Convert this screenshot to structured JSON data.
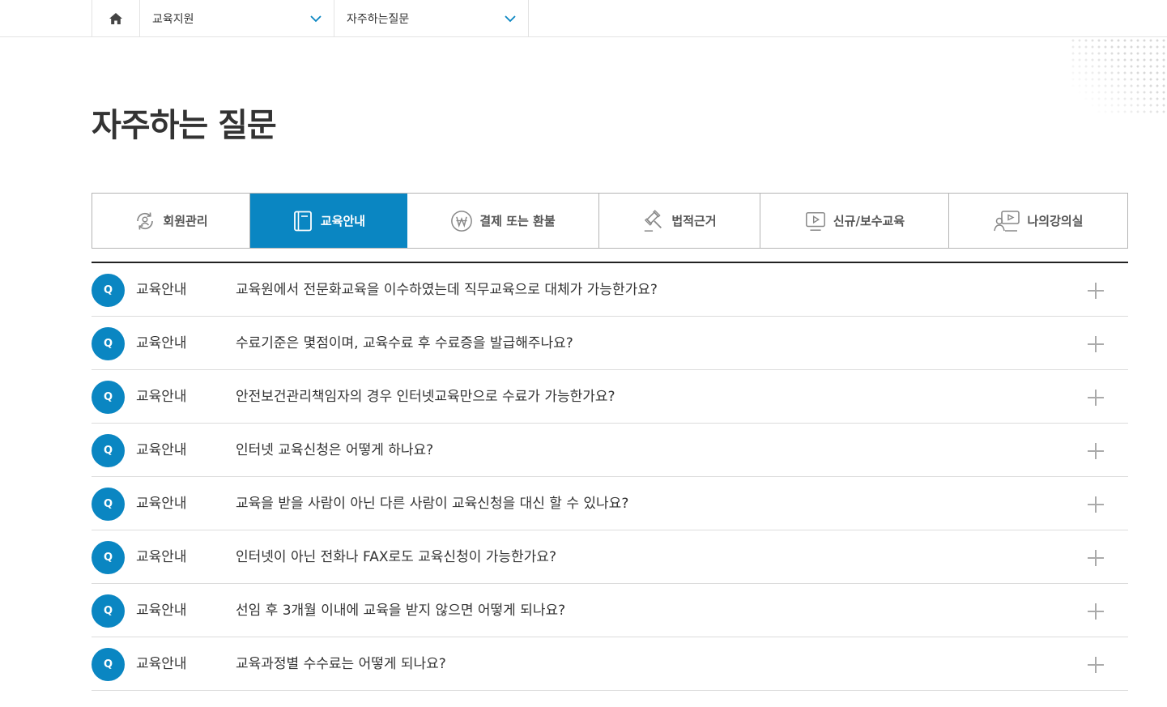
{
  "breadcrumb": {
    "home_icon": "home-icon",
    "level1": "교육지원",
    "level2": "자주하는질문"
  },
  "page": {
    "title": "자주하는 질문"
  },
  "tabs": [
    {
      "label": "회원관리",
      "icon": "member-cycle-icon",
      "active": false
    },
    {
      "label": "교육안내",
      "icon": "book-icon",
      "active": true
    },
    {
      "label": "결제 또는 환불",
      "icon": "won-coin-icon",
      "active": false
    },
    {
      "label": "법적근거",
      "icon": "gavel-icon",
      "active": false
    },
    {
      "label": "신규/보수교육",
      "icon": "video-play-icon",
      "active": false
    },
    {
      "label": "나의강의실",
      "icon": "user-screen-icon",
      "active": false
    }
  ],
  "faq": {
    "q_badge": "Q",
    "items": [
      {
        "category": "교육안내",
        "question": "교육원에서 전문화교육을 이수하였는데 직무교육으로 대체가 가능한가요?"
      },
      {
        "category": "교육안내",
        "question": "수료기준은 몇점이며, 교육수료 후 수료증을 발급해주나요?"
      },
      {
        "category": "교육안내",
        "question": "안전보건관리책임자의 경우 인터넷교육만으로 수료가 가능한가요?"
      },
      {
        "category": "교육안내",
        "question": "인터넷 교육신청은 어떻게 하나요?"
      },
      {
        "category": "교육안내",
        "question": "교육을 받을 사람이 아닌 다른 사람이 교육신청을 대신 할 수 있나요?"
      },
      {
        "category": "교육안내",
        "question": "인터넷이 아닌 전화나 FAX로도 교육신청이 가능한가요?"
      },
      {
        "category": "교육안내",
        "question": "선임 후 3개월 이내에 교육을 받지 않으면 어떻게 되나요?"
      },
      {
        "category": "교육안내",
        "question": "교육과정별 수수료는 어떻게 되나요?"
      }
    ]
  },
  "colors": {
    "accent": "#0a86c2",
    "text": "#333333",
    "border": "#b5b5b5"
  }
}
